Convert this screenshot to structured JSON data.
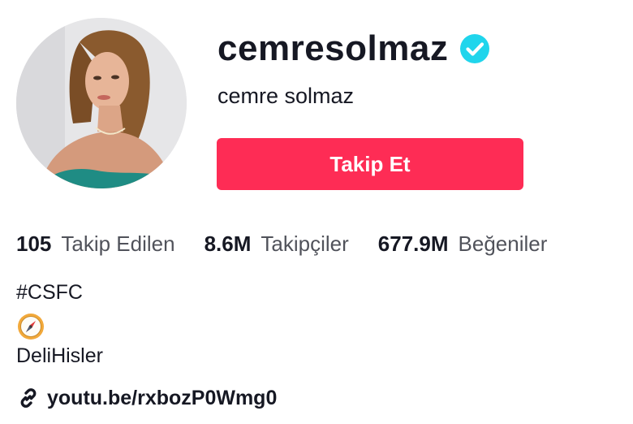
{
  "profile": {
    "username": "cemresolmaz",
    "nickname": "cemre solmaz",
    "follow_label": "Takip Et"
  },
  "stats": [
    {
      "count": "105",
      "label": "Takip Edilen"
    },
    {
      "count": "8.6M",
      "label": "Takipçiler"
    },
    {
      "count": "677.9M",
      "label": "Beğeniler"
    }
  ],
  "bio": {
    "line1": "#CSFC",
    "line2": "DeliHisler",
    "link": "youtu.be/rxbozP0Wmg0"
  },
  "icons": {
    "verified": "verified-badge-icon",
    "compass": "compass-emoji-icon",
    "link": "link-icon"
  },
  "colors": {
    "follow_button": "#fe2c55",
    "verified_badge": "#20d5ec",
    "text_primary": "#161823"
  }
}
